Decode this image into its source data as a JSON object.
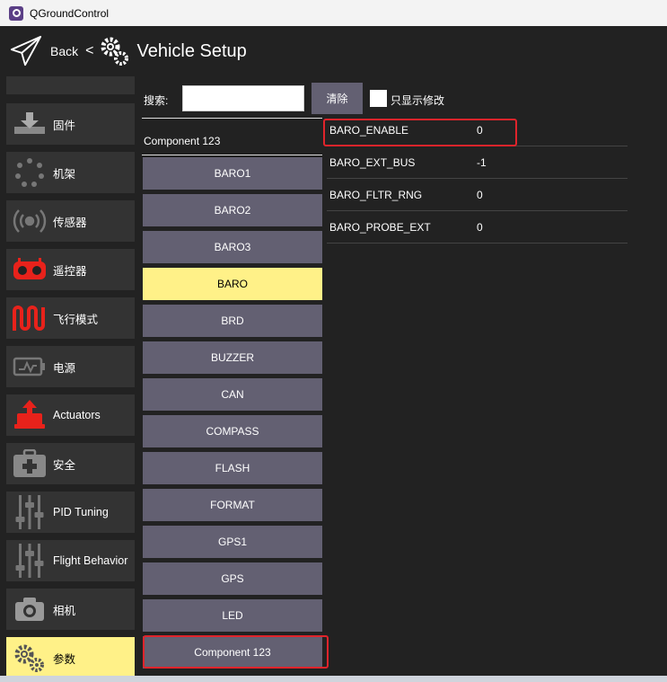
{
  "window": {
    "title": "QGroundControl"
  },
  "toolbar": {
    "back_label": "Back",
    "separator": "<",
    "title": "Vehicle Setup"
  },
  "sidebar": {
    "items": [
      {
        "label": "",
        "icon": "partial-icon"
      },
      {
        "label": "固件",
        "icon": "firmware-icon"
      },
      {
        "label": "机架",
        "icon": "airframe-icon"
      },
      {
        "label": "传感器",
        "icon": "sensors-icon"
      },
      {
        "label": "遥控器",
        "icon": "radio-icon"
      },
      {
        "label": "飞行模式",
        "icon": "flight-modes-icon"
      },
      {
        "label": "电源",
        "icon": "power-icon"
      },
      {
        "label": "Actuators",
        "icon": "actuators-icon"
      },
      {
        "label": "安全",
        "icon": "safety-icon"
      },
      {
        "label": "PID Tuning",
        "icon": "pid-tuning-icon"
      },
      {
        "label": "Flight Behavior",
        "icon": "flight-behavior-icon"
      },
      {
        "label": "相机",
        "icon": "camera-icon"
      },
      {
        "label": "参数",
        "icon": "parameters-icon",
        "active": true
      }
    ]
  },
  "search": {
    "label": "搜索:",
    "value": "",
    "clear_label": "清除",
    "modified_only_label": "只显示修改"
  },
  "groups": {
    "header": "Component 123",
    "buttons": [
      "BARO1",
      "BARO2",
      "BARO3",
      "BARO",
      "BRD",
      "BUZZER",
      "CAN",
      "COMPASS",
      "FLASH",
      "FORMAT",
      "GPS1",
      "GPS",
      "LED",
      "Component 123"
    ],
    "active": "BARO"
  },
  "params": [
    {
      "name": "BARO_ENABLE",
      "value": "0"
    },
    {
      "name": "BARO_EXT_BUS",
      "value": "-1"
    },
    {
      "name": "BARO_FLTR_RNG",
      "value": "0"
    },
    {
      "name": "BARO_PROBE_EXT",
      "value": "0"
    }
  ],
  "colors": {
    "background": "#222222",
    "button": "#636072",
    "active": "#fff188",
    "sidebar_item": "#333333",
    "highlight_box": "#e0242b",
    "icon_red": "#e8221b"
  }
}
